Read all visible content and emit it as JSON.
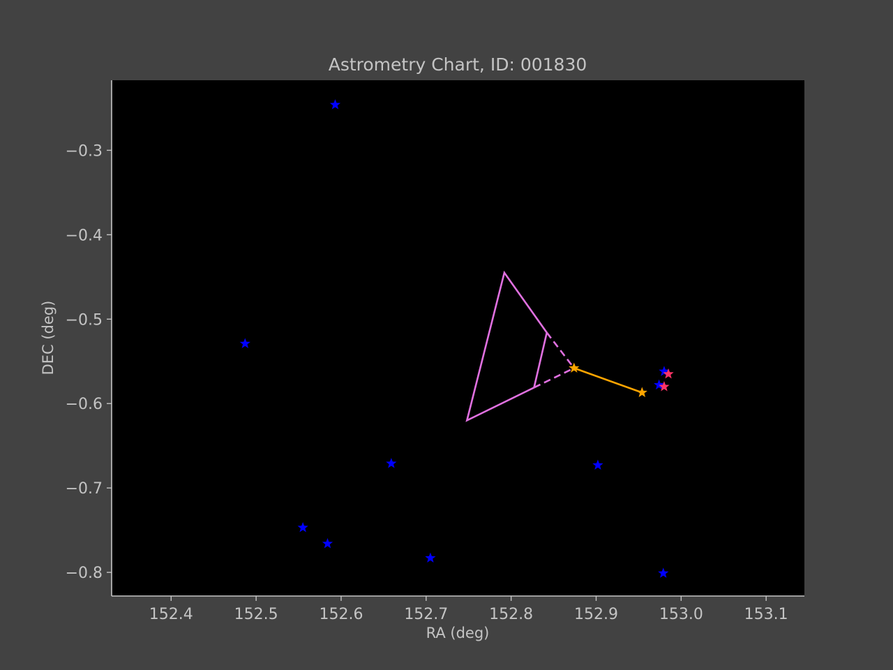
{
  "chart_data": {
    "type": "scatter",
    "title": "Astrometry Chart, ID: 001830",
    "xlabel": "RA (deg)",
    "ylabel": "DEC (deg)",
    "xlim": [
      152.33,
      153.145
    ],
    "ylim": [
      -0.828,
      -0.217
    ],
    "xticks": [
      152.4,
      152.5,
      152.6,
      152.7,
      152.8,
      152.9,
      153.0,
      153.1
    ],
    "xtick_labels": [
      "152.4",
      "152.5",
      "152.6",
      "152.7",
      "152.8",
      "152.9",
      "153.0",
      "153.1"
    ],
    "yticks": [
      -0.3,
      -0.4,
      -0.5,
      -0.6,
      -0.7,
      -0.8
    ],
    "ytick_labels": [
      "−0.3",
      "−0.4",
      "−0.5",
      "−0.6",
      "−0.7",
      "−0.8"
    ],
    "grid": false,
    "colors": {
      "background": "#424242",
      "plot_background": "#000000",
      "text": "#c4c4c4",
      "spine": "#c4c4c4",
      "field_star": "#0000ff",
      "target_star": "#ff3366",
      "path_star": "#ffa500",
      "triangle": "#e070e0"
    },
    "series": [
      {
        "role": "field-stars",
        "marker": "star",
        "color": "#0000ff",
        "points": [
          [
            152.593,
            -0.246
          ],
          [
            152.487,
            -0.529
          ],
          [
            152.659,
            -0.671
          ],
          [
            152.555,
            -0.747
          ],
          [
            152.584,
            -0.766
          ],
          [
            152.705,
            -0.783
          ],
          [
            152.902,
            -0.673
          ],
          [
            152.98,
            -0.562
          ],
          [
            152.974,
            -0.578
          ],
          [
            152.979,
            -0.801
          ]
        ]
      },
      {
        "role": "target-stars",
        "marker": "star",
        "color": "#ff3366",
        "points": [
          [
            152.985,
            -0.565
          ],
          [
            152.98,
            -0.58
          ]
        ]
      },
      {
        "role": "path-stars",
        "marker": "star",
        "color": "#ffa500",
        "points": [
          [
            152.874,
            -0.558
          ],
          [
            152.954,
            -0.587
          ]
        ]
      }
    ],
    "lines": [
      {
        "role": "path-line",
        "color": "#ffa500",
        "style": "solid",
        "points": [
          [
            152.874,
            -0.558
          ],
          [
            152.954,
            -0.587
          ]
        ]
      },
      {
        "role": "triangle-outline",
        "color": "#e070e0",
        "style": "solid",
        "points": [
          [
            152.842,
            -0.516
          ],
          [
            152.792,
            -0.445
          ],
          [
            152.748,
            -0.62
          ],
          [
            152.827,
            -0.581
          ]
        ]
      },
      {
        "role": "triangle-inner",
        "color": "#e070e0",
        "style": "solid",
        "points": [
          [
            152.842,
            -0.516
          ],
          [
            152.827,
            -0.581
          ]
        ]
      },
      {
        "role": "triangle-dashed-upper",
        "color": "#e070e0",
        "style": "dashed",
        "points": [
          [
            152.842,
            -0.516
          ],
          [
            152.874,
            -0.558
          ]
        ]
      },
      {
        "role": "triangle-dashed-lower",
        "color": "#e070e0",
        "style": "dashed",
        "points": [
          [
            152.827,
            -0.581
          ],
          [
            152.874,
            -0.558
          ]
        ]
      }
    ]
  }
}
